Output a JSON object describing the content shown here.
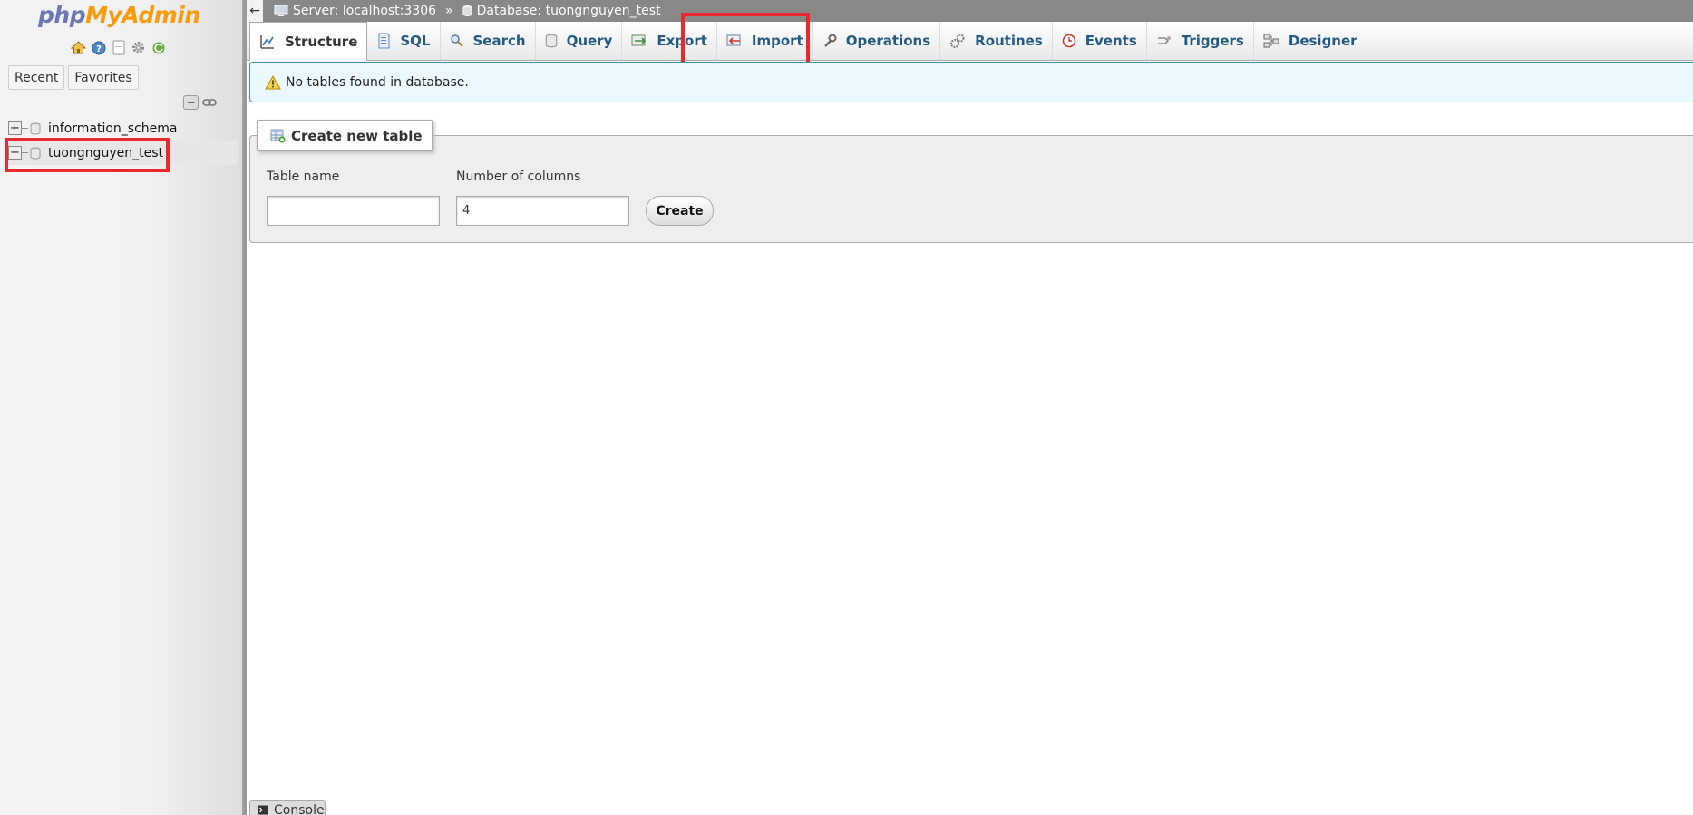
{
  "navigation": {
    "logo_php": "php",
    "logo_myadmin": "MyAdmin",
    "icons": [
      "home-icon",
      "help-icon",
      "documentation-icon",
      "settings-icon",
      "reload-icon"
    ],
    "recent_label": "Recent",
    "favorites_label": "Favorites",
    "databases": [
      {
        "name": "information_schema",
        "expanded": false,
        "expander": "+"
      },
      {
        "name": "tuongnguyen_test",
        "expanded": true,
        "expander": "−"
      }
    ]
  },
  "breadcrumb": {
    "back": "←",
    "server": "Server: localhost:3306",
    "separator": "»",
    "database": "Database: tuongnguyen_test"
  },
  "tabs": [
    {
      "label": "Structure",
      "icon": "structure-icon",
      "active": true
    },
    {
      "label": "SQL",
      "icon": "sql-icon"
    },
    {
      "label": "Search",
      "icon": "search-icon"
    },
    {
      "label": "Query",
      "icon": "query-icon"
    },
    {
      "label": "Export",
      "icon": "export-icon"
    },
    {
      "label": "Import",
      "icon": "import-icon"
    },
    {
      "label": "Operations",
      "icon": "operations-icon"
    },
    {
      "label": "Routines",
      "icon": "routines-icon"
    },
    {
      "label": "Events",
      "icon": "events-icon"
    },
    {
      "label": "Triggers",
      "icon": "triggers-icon"
    },
    {
      "label": "Designer",
      "icon": "designer-icon"
    }
  ],
  "notice": {
    "text": "No tables found in database.",
    "icon": "warning-icon"
  },
  "create_table": {
    "legend": "Create new table",
    "table_name_label": "Table name",
    "table_name_value": "",
    "columns_label": "Number of columns",
    "columns_value": "4",
    "create_label": "Create"
  },
  "console": {
    "label": "Console"
  },
  "colors": {
    "tab_text": "#235a81",
    "highlight": "#e62a2d",
    "notice_bg": "#ebf8fd",
    "logo_php": "#6c78af",
    "logo_myadmin": "#f89c0e"
  }
}
